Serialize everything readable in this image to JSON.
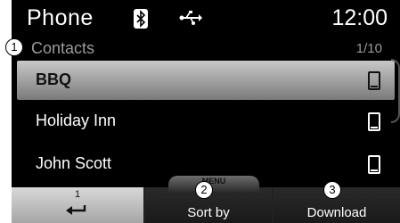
{
  "statusbar": {
    "title": "Phone",
    "time": "12:00",
    "icons": [
      "bluetooth-icon",
      "usb-icon"
    ]
  },
  "callouts": [
    "1",
    "2",
    "3"
  ],
  "list": {
    "header": "Contacts",
    "page": "1/10",
    "items": [
      {
        "label": "BBQ",
        "icon": "mobile-phone-icon",
        "selected": true
      },
      {
        "label": "Holiday Inn",
        "icon": "mobile-phone-icon",
        "selected": false
      },
      {
        "label": "John Scott",
        "icon": "mobile-phone-icon",
        "selected": false
      }
    ]
  },
  "menu_tab": "MENU",
  "softkeys": {
    "back_number": "1",
    "sort_number": "2",
    "sort_label": "Sort by",
    "download_label": "Download"
  },
  "colors": {
    "background": "#000000",
    "selected_row": "#b0b0b0",
    "dim_text": "#9a9a9a"
  }
}
